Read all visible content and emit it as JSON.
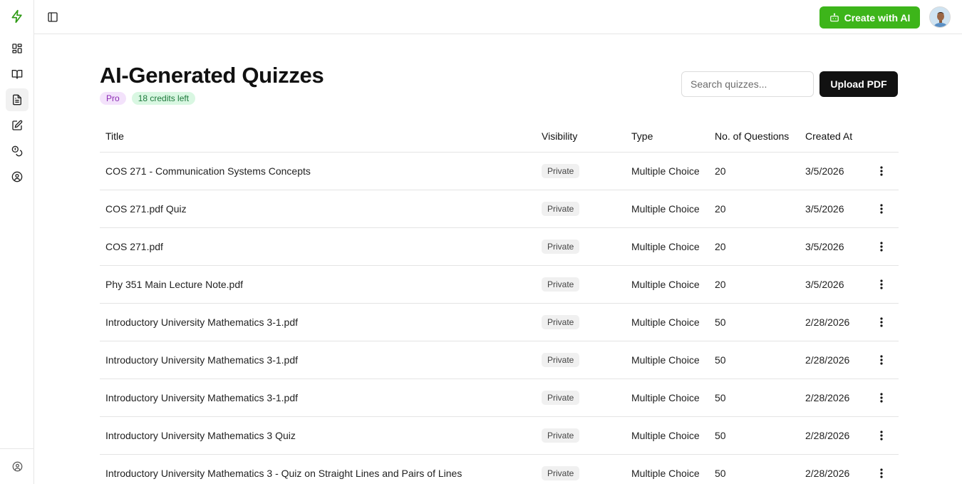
{
  "sidebar": {
    "logo_icon": "lightning-bolt-icon",
    "items": [
      {
        "icon": "dashboard-grid-icon",
        "active": false
      },
      {
        "icon": "open-book-icon",
        "active": false
      },
      {
        "icon": "document-icon",
        "active": true
      },
      {
        "icon": "edit-square-icon",
        "active": false
      },
      {
        "icon": "coins-icon",
        "active": false
      },
      {
        "icon": "user-circle-icon",
        "active": false
      }
    ],
    "footer_icon": "user-circle-icon"
  },
  "topbar": {
    "create_label": "Create with AI",
    "create_color": "#3db51a"
  },
  "page": {
    "title": "AI-Generated Quizzes",
    "plan_badge": "Pro",
    "credits_badge": "18 credits left",
    "search_placeholder": "Search quizzes...",
    "upload_label": "Upload PDF"
  },
  "table": {
    "headers": {
      "title": "Title",
      "visibility": "Visibility",
      "type": "Type",
      "questions": "No. of Questions",
      "created": "Created At"
    },
    "rows": [
      {
        "title": "COS 271 - Communication Systems Concepts",
        "visibility": "Private",
        "type": "Multiple Choice",
        "questions": "20",
        "created": "3/5/2026"
      },
      {
        "title": "COS 271.pdf Quiz",
        "visibility": "Private",
        "type": "Multiple Choice",
        "questions": "20",
        "created": "3/5/2026"
      },
      {
        "title": "COS 271.pdf",
        "visibility": "Private",
        "type": "Multiple Choice",
        "questions": "20",
        "created": "3/5/2026"
      },
      {
        "title": "Phy 351 Main Lecture Note.pdf",
        "visibility": "Private",
        "type": "Multiple Choice",
        "questions": "20",
        "created": "3/5/2026"
      },
      {
        "title": "Introductory University Mathematics 3-1.pdf",
        "visibility": "Private",
        "type": "Multiple Choice",
        "questions": "50",
        "created": "2/28/2026"
      },
      {
        "title": "Introductory University Mathematics 3-1.pdf",
        "visibility": "Private",
        "type": "Multiple Choice",
        "questions": "50",
        "created": "2/28/2026"
      },
      {
        "title": "Introductory University Mathematics 3-1.pdf",
        "visibility": "Private",
        "type": "Multiple Choice",
        "questions": "50",
        "created": "2/28/2026"
      },
      {
        "title": "Introductory University Mathematics 3 Quiz",
        "visibility": "Private",
        "type": "Multiple Choice",
        "questions": "50",
        "created": "2/28/2026"
      },
      {
        "title": "Introductory University Mathematics 3 - Quiz on Straight Lines and Pairs of Lines",
        "visibility": "Private",
        "type": "Multiple Choice",
        "questions": "50",
        "created": "2/28/2026"
      }
    ]
  }
}
